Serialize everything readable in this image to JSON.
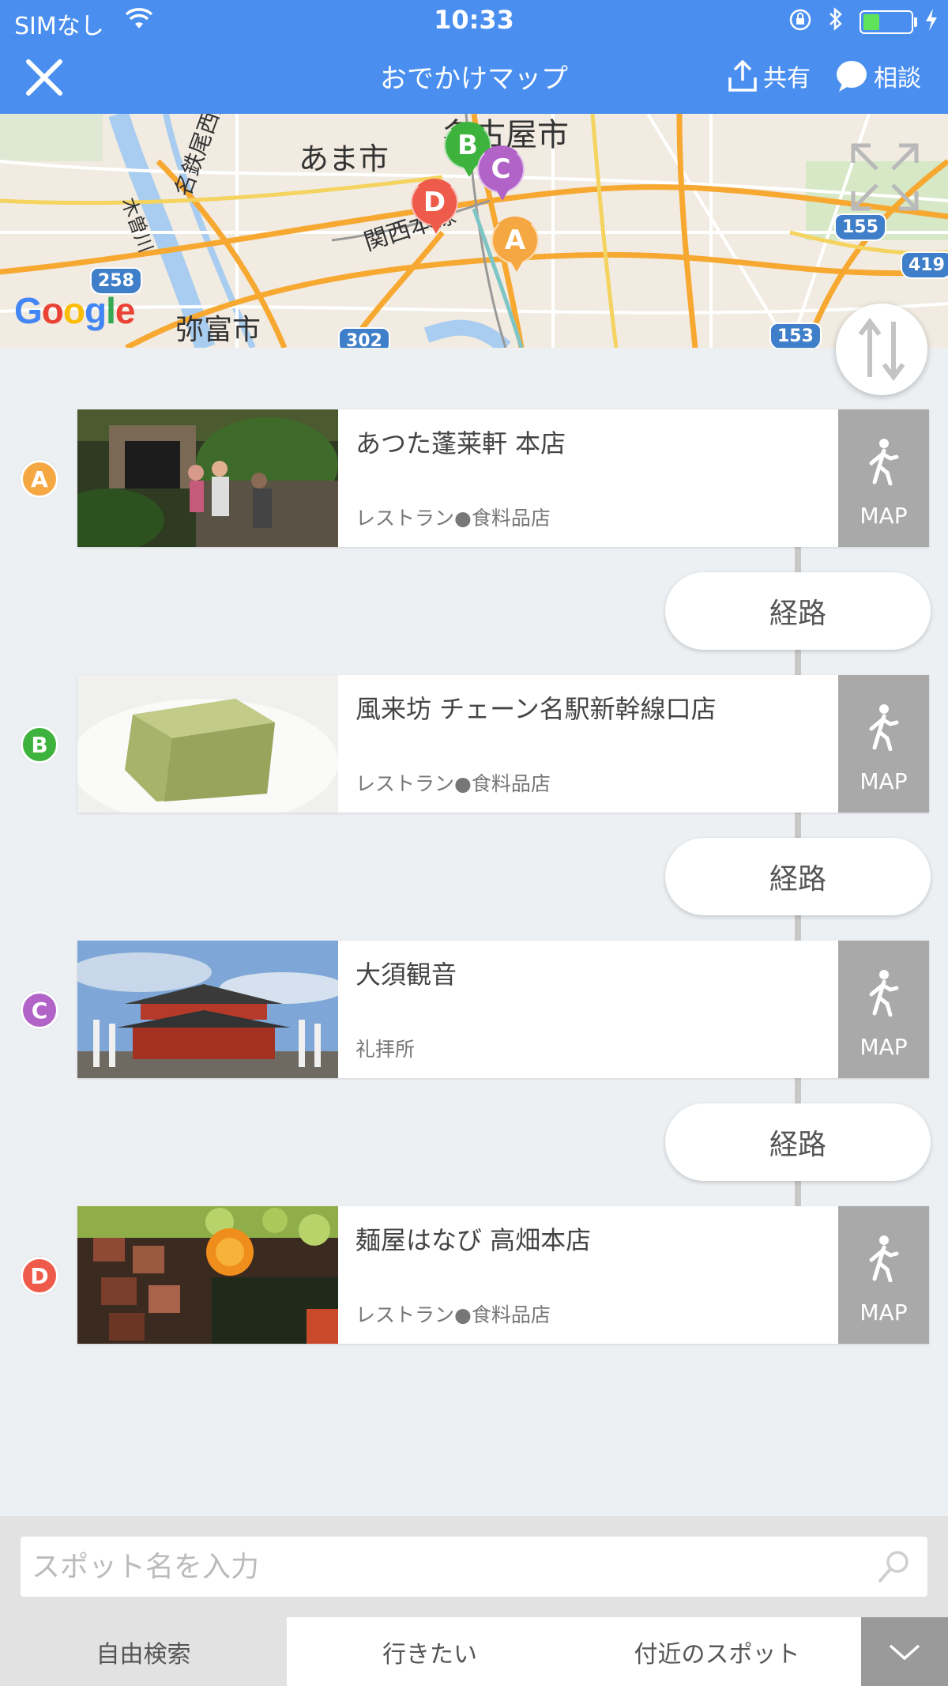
{
  "status_bar": {
    "carrier": "SIMなし",
    "time": "10:33",
    "battery_level": 0.35
  },
  "header": {
    "title": "おでかけマップ",
    "share_label": "共有",
    "consult_label": "相談"
  },
  "map": {
    "labels": {
      "nagoya": "名古屋市",
      "ama": "あま市",
      "yatomi": "弥富市",
      "kansai_line": "関西本線",
      "meitetsu_line": "名鉄尾西線",
      "kiso_river": "木曽川"
    },
    "routes": [
      "258",
      "302",
      "155",
      "419",
      "153"
    ],
    "google": "Google",
    "pins": [
      {
        "letter": "A",
        "color": "#f5a742"
      },
      {
        "letter": "B",
        "color": "#3db33d"
      },
      {
        "letter": "C",
        "color": "#b163c8"
      },
      {
        "letter": "D",
        "color": "#ef5b4b"
      }
    ]
  },
  "spots": [
    {
      "marker": "A",
      "marker_color": "#f5a742",
      "name": "あつた蓬莱軒 本店",
      "category": "レストラン●食料品店",
      "map_label": "MAP"
    },
    {
      "marker": "B",
      "marker_color": "#3db33d",
      "name": "風来坊 チェーン名駅新幹線口店",
      "category": "レストラン●食料品店",
      "map_label": "MAP"
    },
    {
      "marker": "C",
      "marker_color": "#b163c8",
      "name": "大須観音",
      "category": "礼拝所",
      "map_label": "MAP"
    },
    {
      "marker": "D",
      "marker_color": "#ef5b4b",
      "name": "麺屋はなび 高畑本店",
      "category": "レストラン●食料品店",
      "map_label": "MAP"
    }
  ],
  "routes": [
    {
      "label": "経路"
    },
    {
      "label": "経路"
    },
    {
      "label": "経路"
    }
  ],
  "search": {
    "placeholder": "スポット名を入力",
    "value": ""
  },
  "tabs": {
    "free_search": "自由検索",
    "want_to_go": "行きたい",
    "nearby": "付近のスポット"
  }
}
